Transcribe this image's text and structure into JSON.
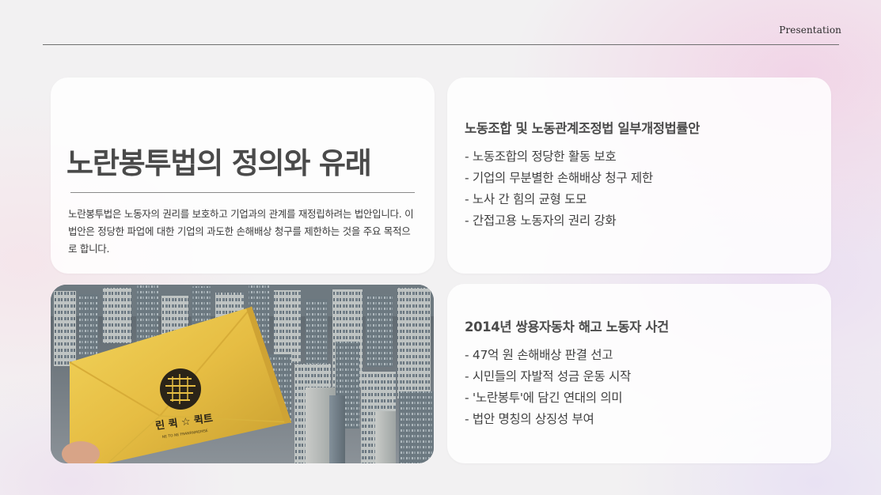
{
  "header": {
    "label": "Presentation"
  },
  "intro": {
    "title": "노란봉투법의 정의와 유래",
    "description": "노란봉투법은 노동자의 권리를 보호하고 기업과의 관계를 재정립하려는 법안입니다. 이 법안은 정당한 파업에 대한 기업의 과도한 손해배상 청구를 제한하는 것을 주요 목적으로 합니다."
  },
  "law_card": {
    "heading": "노동조합 및 노동관계조정법 일부개정법률안",
    "items": [
      "- 노동조합의 정당한 활동 보호",
      "- 기업의 무분별한 손해배상 청구 제한",
      "- 노사 간 힘의 균형 도모",
      "- 간접고용 노동자의 권리 강화"
    ]
  },
  "case_card": {
    "heading": "2014년 쌍용자동차 해고 노동자 사건",
    "items": [
      "- 47억 원 손해배상 판결 선고",
      "- 시민들의 자발적 성금 운동 시작",
      "- '노란봉투'에 담긴 연대의 의미",
      "- 법안 명칭의 상징성 부여"
    ]
  },
  "image": {
    "envelope_text": "린 퀵 ☆ 퀵트",
    "envelope_subtext": "NE TO NE FRANRNMGMSE",
    "colors": {
      "envelope": "#e6bd43",
      "city": "#748089",
      "seal": "#2b2418"
    }
  }
}
